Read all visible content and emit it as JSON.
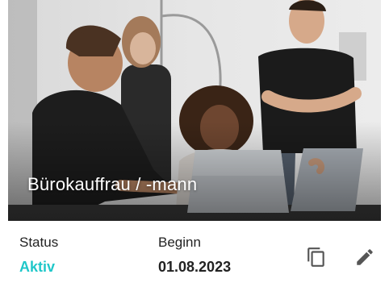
{
  "card": {
    "title": "Bürokauffrau / -mann",
    "status": {
      "label": "Status",
      "value": "Aktiv"
    },
    "start": {
      "label": "Beginn",
      "value": "01.08.2023"
    },
    "actions": [
      {
        "icon": "copy-icon"
      },
      {
        "icon": "edit-icon"
      }
    ]
  },
  "colors": {
    "status_active": "#20c7c9",
    "label_text": "#222222",
    "icon": "#555555"
  }
}
